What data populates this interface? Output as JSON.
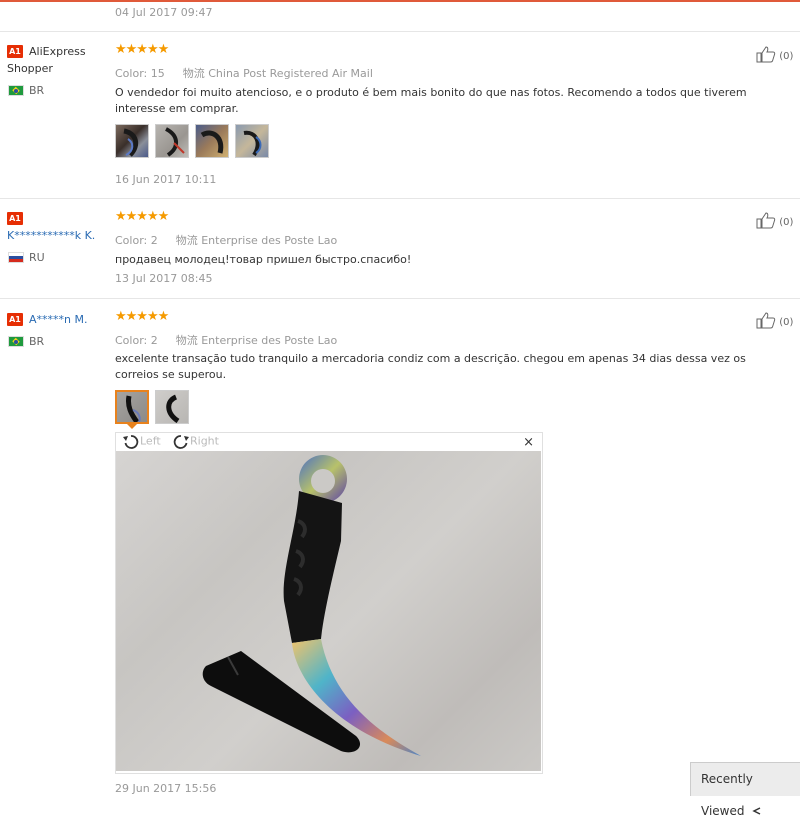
{
  "top_date": "04 Jul 2017 09:47",
  "reviews": [
    {
      "badge": "A1",
      "user": "AliExpress Shopper",
      "user_line1": "AliExpress",
      "user_line2": "Shopper",
      "country": "BR",
      "stars": "★★★★★",
      "color_label": "Color: 15",
      "logistics": "物流 China Post Registered Air Mail",
      "text": "O vendedor foi muito atencioso, e o produto é bem mais bonito do que nas fotos. Recomendo a todos que tiverem interesse em comprar.",
      "helpful": "(0)",
      "photos": 4,
      "date": "16 Jun 2017 10:11"
    },
    {
      "badge": "A1",
      "user": "K***********k K.",
      "country": "RU",
      "stars": "★★★★★",
      "color_label": "Color: 2",
      "logistics": "物流 Enterprise des Poste Lao",
      "text": "продавец молодец!товар пришел быстро.спасибо!",
      "helpful": "(0)",
      "date": "13 Jul 2017 08:45"
    },
    {
      "badge": "A1",
      "user": "A*****n M.",
      "country": "BR",
      "stars": "★★★★★",
      "color_label": "Color: 2",
      "logistics": "物流 Enterprise des Poste Lao",
      "text": "excelente transação tudo tranquilo a mercadoria condiz com a descrição. chegou em apenas 34 dias dessa vez os correios se superou.",
      "helpful": "(0)",
      "photos": 2,
      "date": "29 Jun 2017 15:56"
    }
  ],
  "viewer": {
    "left_label": "Left",
    "right_label": "Right",
    "close": "×"
  },
  "recently_viewed": "Recently Viewed"
}
